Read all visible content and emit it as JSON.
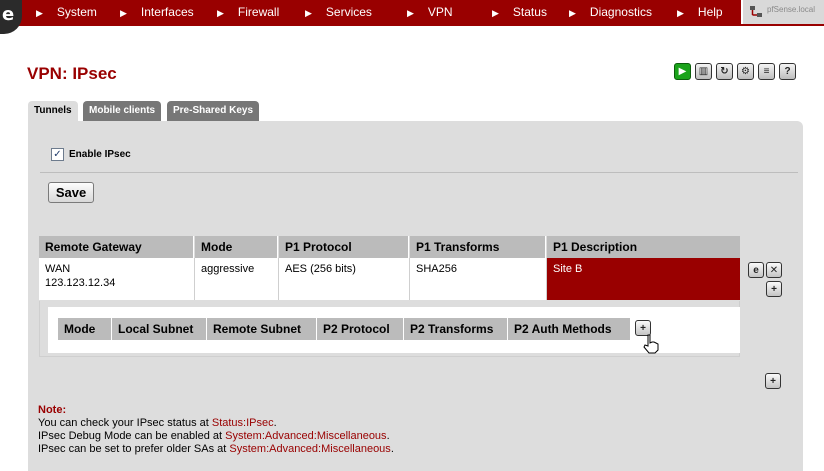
{
  "nav": {
    "logo_letter": "e",
    "items": [
      "System",
      "Interfaces",
      "Firewall",
      "Services",
      "VPN",
      "Status",
      "Diagnostics",
      "Help"
    ],
    "host_text": "pfSense.local"
  },
  "page": {
    "title": "VPN: IPsec"
  },
  "header_icons": [
    "play-icon",
    "log-icon",
    "restart-icon",
    "settings-icon",
    "list-icon",
    "help-icon"
  ],
  "tabs": [
    {
      "label": "Tunnels",
      "active": true
    },
    {
      "label": "Mobile clients",
      "active": false
    },
    {
      "label": "Pre-Shared Keys",
      "active": false
    }
  ],
  "enable": {
    "label": "Enable IPsec",
    "checked": true,
    "check_glyph": "✓"
  },
  "save_label": "Save",
  "p1": {
    "headers": [
      "Remote Gateway",
      "Mode",
      "P1 Protocol",
      "P1 Transforms",
      "P1 Description"
    ],
    "row": {
      "gateway_iface": "WAN",
      "gateway_ip": "123.123.12.34",
      "mode": "aggressive",
      "protocol": "AES (256 bits)",
      "transforms": "SHA256",
      "description": "Site B"
    }
  },
  "p2": {
    "headers": [
      "Mode",
      "Local Subnet",
      "Remote Subnet",
      "P2 Protocol",
      "P2 Transforms",
      "P2 Auth Methods"
    ]
  },
  "notes": {
    "title": "Note:",
    "line1_prefix": "You can check your IPsec status at ",
    "line1_link": "Status:IPsec",
    "line1_suffix": ".",
    "line2_prefix": "IPsec Debug Mode can be enabled at ",
    "line2_link": "System:Advanced:Miscellaneous",
    "line2_suffix": ".",
    "line3_prefix": "IPsec can be set to prefer older SAs at ",
    "line3_link": "System:Advanced:Miscellaneous",
    "line3_suffix": "."
  },
  "colors": {
    "brand": "#990000",
    "panel": "#dddddd",
    "header_cell": "#bbbbbb",
    "tab_inactive": "#777777"
  }
}
